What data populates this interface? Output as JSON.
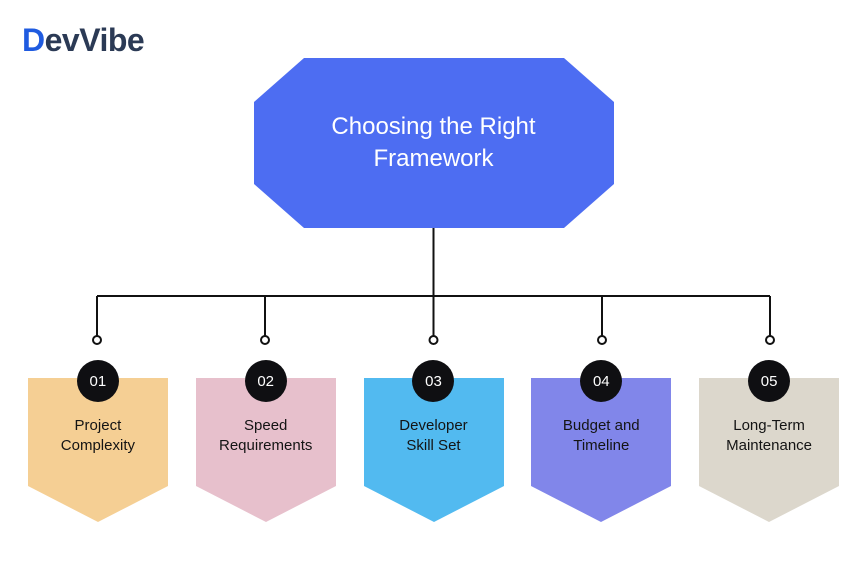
{
  "logo": {
    "accent_letter": "D",
    "rest": "evVibe"
  },
  "banner": {
    "title": "Choosing the\nRight Framework",
    "fill": "#4d6df2"
  },
  "connector": {
    "stroke": "#111111"
  },
  "cards": [
    {
      "num": "01",
      "label": "Project\nComplexity",
      "fill": "#f5cf94"
    },
    {
      "num": "02",
      "label": "Speed\nRequirements",
      "fill": "#e7c0cc"
    },
    {
      "num": "03",
      "label": "Developer\nSkill Set",
      "fill": "#52baf0"
    },
    {
      "num": "04",
      "label": "Budget and\nTimeline",
      "fill": "#8186ea"
    },
    {
      "num": "05",
      "label": "Long-Term\nMaintenance",
      "fill": "#dcd7cc"
    }
  ]
}
